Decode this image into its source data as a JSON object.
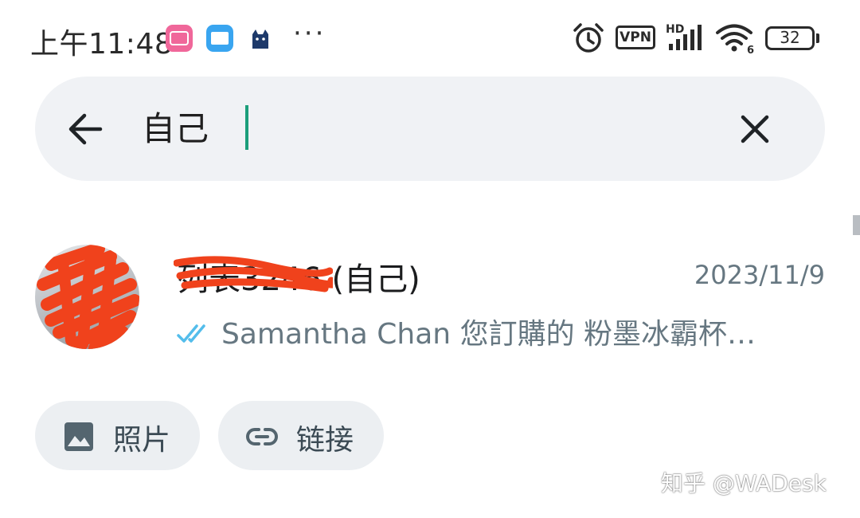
{
  "status_bar": {
    "time": "上午11:48",
    "app_icons": [
      "bilibili-icon",
      "mail-icon",
      "cat-icon"
    ],
    "overflow": "···",
    "vpn_label": "VPN",
    "network_label": "HD",
    "wifi_label": "6",
    "battery_level": "32"
  },
  "search": {
    "query": "自己",
    "back_icon": "arrow-left-icon",
    "clear_icon": "close-icon"
  },
  "result": {
    "name": "列表3246 (自己)",
    "date": "2023/11/9",
    "read_icon": "double-check-icon",
    "preview": "Samantha Chan 您訂購的 粉墨冰霸杯…"
  },
  "filters": [
    {
      "label": "照片",
      "icon": "image-icon"
    },
    {
      "label": "链接",
      "icon": "link-icon"
    }
  ],
  "watermark": "知乎 @WADesk",
  "colors": {
    "accent": "#1b9e7a",
    "search_bg": "#f0f2f5",
    "chip_bg": "#eceff2",
    "secondary_text": "#667781",
    "tick_blue": "#53bdeb",
    "redaction": "#f0421c"
  }
}
